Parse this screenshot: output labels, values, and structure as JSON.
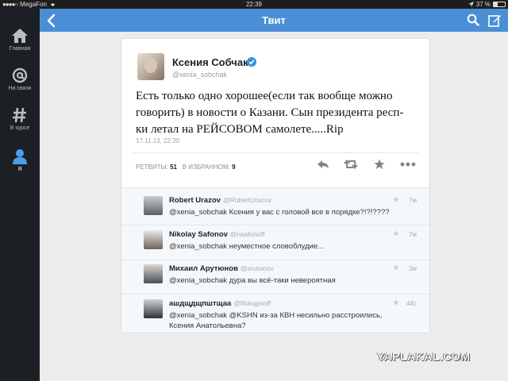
{
  "status_bar": {
    "carrier": "MegaFon",
    "time": "22:39",
    "battery": "37 %",
    "battery_level": 0.37
  },
  "sidebar": {
    "items": [
      {
        "label": "Главная",
        "icon": "home-icon"
      },
      {
        "label": "На связи",
        "icon": "at-icon"
      },
      {
        "label": "В курсе",
        "icon": "hashtag-icon"
      },
      {
        "label": "Я",
        "icon": "user-icon",
        "active": true
      }
    ]
  },
  "topbar": {
    "title": "Твит",
    "icons": [
      "back-icon",
      "search-icon",
      "compose-icon"
    ]
  },
  "tweet": {
    "author_name": "Ксения Собчак",
    "author_handle": "@xenia_sobchak",
    "verified": true,
    "text": "Есть только одно хорошее(если так вообще можно говорить) в новости о Казани. Сын президента респ-ки летал на РЕЙСОВОМ  самолете.....Rip",
    "date": "17.11.13, 22:30",
    "retweets_label": "РЕТВИТЫ:",
    "retweets": "51",
    "favorites_label": "В ИЗБРАННОМ:",
    "favorites": "9",
    "actions": [
      "reply-icon",
      "retweet-icon",
      "favorite-icon",
      "more-icon"
    ]
  },
  "replies": [
    {
      "name": "Robert Urazov",
      "handle": "@RobertUrazov",
      "time": "7м",
      "text": "@xenia_sobchak Ксения у вас с головой все в порядке?!?!????"
    },
    {
      "name": "Nikolay Safonov",
      "handle": "@nsafonoff",
      "time": "7м",
      "text": "@xenia_sobchak неуместное словоблудие..."
    },
    {
      "name": "Михаил Арутюнов",
      "handle": "@arutunov",
      "time": "3м",
      "text": "@xenia_sobchak дура вы всё-таки невероятная"
    },
    {
      "name": "ашдщдщпштщаа",
      "handle": "@filologinoff",
      "time": "44с",
      "text": "@xenia_sobchak @KSHN из-за КВН несильно расстроились, Ксения Анатольевна?"
    }
  ],
  "colors": {
    "topbar": "#4a8fd6",
    "sidebar": "#1c1f24",
    "verified": "#3b94d9"
  },
  "watermark": "YAPLAKAL.COM"
}
